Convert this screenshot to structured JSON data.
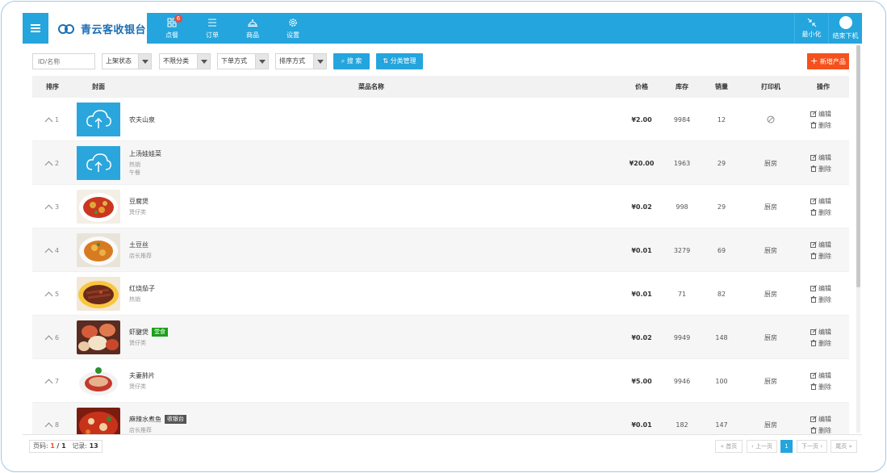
{
  "header": {
    "brand": "青云客收银台",
    "nav": [
      {
        "label": "点餐",
        "icon": "grid-icon",
        "badge": "6"
      },
      {
        "label": "订单",
        "icon": "list-icon"
      },
      {
        "label": "商品",
        "icon": "dish-cover-icon"
      },
      {
        "label": "设置",
        "icon": "gear-icon"
      }
    ],
    "minimize_label": "最小化",
    "logout_label": "结束下机"
  },
  "toolbar": {
    "id_placeholder": "ID/名称",
    "filter_status": "上架状态",
    "filter_category": "不限分类",
    "filter_order_mode": "下单方式",
    "filter_sort_mode": "排序方式",
    "search_label": "搜 索",
    "category_manage_label": "分类管理",
    "add_product_label": "新增产品"
  },
  "table": {
    "headers": [
      "排序",
      "封面",
      "菜品名称",
      "价格",
      "库存",
      "销量",
      "打印机",
      "操作"
    ],
    "edit_label": "编辑",
    "delete_label": "删除",
    "rows": [
      {
        "sort": "1",
        "cover": "upload",
        "name": "农夫山泉",
        "tag": "",
        "tag_color": "",
        "subs": [],
        "price": "¥2.00",
        "stock": "9984",
        "sales": "12",
        "printer": "",
        "printer_icon": "ban-icon"
      },
      {
        "sort": "2",
        "cover": "upload",
        "name": "上汤娃娃菜",
        "tag": "",
        "tag_color": "",
        "subs": [
          "热销",
          "午餐"
        ],
        "price": "¥20.00",
        "stock": "1963",
        "sales": "29",
        "printer": "厨房"
      },
      {
        "sort": "3",
        "cover": "food-red",
        "name": "豆腐煲",
        "tag": "",
        "tag_color": "",
        "subs": [
          "煲仔类"
        ],
        "price": "¥0.02",
        "stock": "998",
        "sales": "29",
        "printer": "厨房"
      },
      {
        "sort": "4",
        "cover": "food-orange",
        "name": "土豆丝",
        "tag": "",
        "tag_color": "",
        "subs": [
          "店长推荐"
        ],
        "price": "¥0.01",
        "stock": "3279",
        "sales": "69",
        "printer": "厨房"
      },
      {
        "sort": "5",
        "cover": "food-brown",
        "name": "红烧茄子",
        "tag": "",
        "tag_color": "",
        "subs": [
          "热销"
        ],
        "price": "¥0.01",
        "stock": "71",
        "sales": "82",
        "printer": "厨房"
      },
      {
        "sort": "6",
        "cover": "food-shell",
        "name": "虾腱煲",
        "tag": "堂食",
        "tag_color": "green",
        "subs": [
          "煲仔类"
        ],
        "price": "¥0.02",
        "stock": "9949",
        "sales": "148",
        "printer": "厨房"
      },
      {
        "sort": "7",
        "cover": "food-slice",
        "name": "夫妻肺片",
        "tag": "",
        "tag_color": "",
        "subs": [
          "煲仔类"
        ],
        "price": "¥5.00",
        "stock": "9946",
        "sales": "100",
        "printer": "厨房"
      },
      {
        "sort": "8",
        "cover": "food-fish",
        "name": "麻辣水煮鱼",
        "tag": "收银台",
        "tag_color": "gray",
        "subs": [
          "店长推荐"
        ],
        "price": "¥0.01",
        "stock": "182",
        "sales": "147",
        "printer": "厨房"
      }
    ]
  },
  "pager": {
    "page_label": "页码:",
    "current_page": "1",
    "total_pages": "1",
    "records_label": "记录:",
    "records": "13",
    "first": "« 首页",
    "prev": "‹ 上一页",
    "page_button": "1",
    "next": "下一页 ›",
    "last": "尾页 »"
  },
  "colors": {
    "primary": "#24a5dd",
    "accent": "#f4511e",
    "tag_green": "#1aa01a",
    "tag_gray": "#555555"
  }
}
